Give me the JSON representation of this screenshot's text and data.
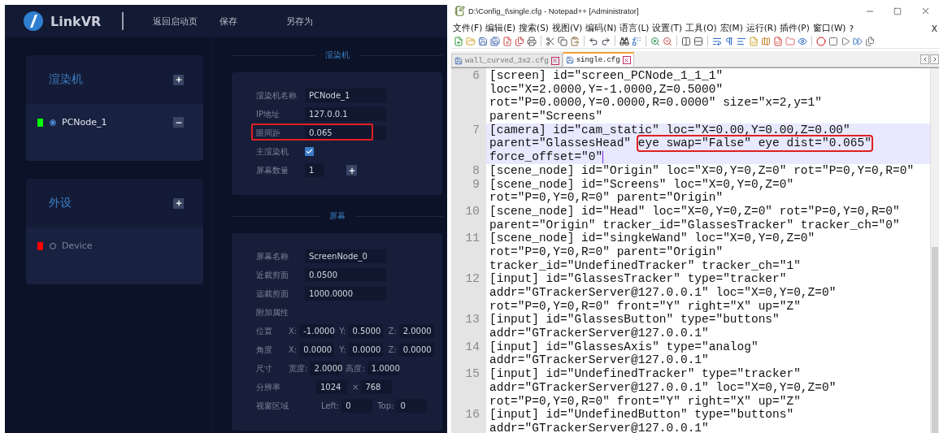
{
  "left_app": {
    "logo": "LinkVR",
    "nav": [
      "返回启动页",
      "保存",
      "另存为"
    ],
    "sidebar_groups": [
      {
        "title": "渲染机",
        "items": [
          {
            "name": "PCNode_1",
            "color": "#00ff00",
            "selected": true
          }
        ]
      },
      {
        "title": "外设",
        "items": [
          {
            "name": "Device",
            "color": "#ff0000",
            "selected": false
          }
        ]
      }
    ],
    "sections": [
      {
        "title": "渲染机",
        "fields": [
          {
            "kind": "text",
            "label": "渲染机名称",
            "value": "PCNode_1",
            "highlighted": false
          },
          {
            "kind": "text",
            "label": "IP地址",
            "value": "127.0.0.1",
            "highlighted": false
          },
          {
            "kind": "text",
            "label": "眼间距",
            "value": "0.065",
            "highlighted": true
          },
          {
            "kind": "checkbox",
            "label": "主渲染机",
            "checked": true
          },
          {
            "kind": "stepper",
            "label": "屏幕数量",
            "value": "1"
          }
        ]
      },
      {
        "title": "屏幕",
        "fields": [
          {
            "kind": "text",
            "label": "屏幕名称",
            "value": "ScreenNode_0",
            "highlighted": false
          },
          {
            "kind": "text",
            "label": "近裁剪面",
            "value": "0.0500",
            "highlighted": false
          },
          {
            "kind": "text",
            "label": "远裁剪面",
            "value": "1000.0000",
            "highlighted": false
          },
          {
            "kind": "heading",
            "label": "附加属性"
          },
          {
            "kind": "multi",
            "label": "位置",
            "parts": [
              {
                "prefix": "X:",
                "value": "-1.0000"
              },
              {
                "prefix": "Y:",
                "value": "0.5000"
              },
              {
                "prefix": "Z:",
                "value": "2.0000"
              }
            ]
          },
          {
            "kind": "multi",
            "label": "角度",
            "parts": [
              {
                "prefix": "X:",
                "value": "0.0000"
              },
              {
                "prefix": "Y:",
                "value": "0.0000"
              },
              {
                "prefix": "Z:",
                "value": "0.0000"
              }
            ]
          },
          {
            "kind": "multi",
            "label": "尺寸",
            "parts": [
              {
                "prefix": "宽度:",
                "value": "2.0000"
              },
              {
                "prefix": "高度:",
                "value": "1.0000"
              }
            ]
          },
          {
            "kind": "multi",
            "label": "分辨率",
            "parts": [
              {
                "value": "1024"
              },
              {
                "prefix": "×",
                "value": "768"
              }
            ]
          },
          {
            "kind": "multi",
            "label": "视窗区域",
            "parts": [
              {
                "prefix": "Left:",
                "value": "0"
              },
              {
                "prefix": "Top:",
                "value": "0"
              }
            ]
          }
        ]
      }
    ]
  },
  "notepad": {
    "title": "D:\\Config_t\\single.cfg - Notepad++ [Administrator]",
    "menu": [
      "文件(F)",
      "编辑(E)",
      "搜索(S)",
      "视图(V)",
      "编码(N)",
      "语言(L)",
      "设置(T)",
      "工具(O)",
      "宏(M)",
      "运行(R)",
      "插件(P)",
      "窗口(W)",
      "?"
    ],
    "doc_close": "X",
    "tabs": [
      {
        "label": "wall_curved_3x2.cfg",
        "selected": false
      },
      {
        "label": "single.cfg",
        "selected": true
      }
    ],
    "lines": [
      {
        "number": "6",
        "current": false,
        "rows": [
          {
            "text": "[screen] id=\"screen_PCNode_1_1_1\""
          },
          {
            "text": "loc=\"X=2.0000,Y=-1.0000,Z=0.5000\""
          },
          {
            "text": "rot=\"P=0.0000,Y=0.0000,R=0.0000\" size=\"x=2,y=1\""
          },
          {
            "text": "parent=\"Screens\""
          }
        ]
      },
      {
        "number": "7",
        "current": true,
        "rows": [
          {
            "text": "[camera] id=\"cam_static\" loc=\"X=0.00,Y=0.00,Z=0.00\""
          },
          {
            "text": "parent=\"GlassesHead\" ",
            "boxed": "eye swap=\"False\" eye dist=\"0.065\""
          },
          {
            "text": "force_offset=\"0\""
          }
        ]
      },
      {
        "number": "8",
        "current": false,
        "rows": [
          {
            "text": "[scene_node] id=\"Origin\" loc=\"X=0,Y=0,Z=0\" rot=\"P=0,Y=0,R=0\""
          }
        ]
      },
      {
        "number": "9",
        "current": false,
        "rows": [
          {
            "text": "[scene_node] id=\"Screens\" loc=\"X=0,Y=0,Z=0\""
          },
          {
            "text": "rot=\"P=0,Y=0,R=0\" parent=\"Origin\""
          }
        ]
      },
      {
        "number": "10",
        "current": false,
        "rows": [
          {
            "text": "[scene_node] id=\"Head\" loc=\"X=0,Y=0,Z=0\" rot=\"P=0,Y=0,R=0\""
          },
          {
            "text": "parent=\"Origin\" tracker_id=\"GlassesTracker\" tracker_ch=\"0\""
          }
        ]
      },
      {
        "number": "11",
        "current": false,
        "rows": [
          {
            "text": "[scene_node] id=\"singkeWand\" loc=\"X=0,Y=0,Z=0\""
          },
          {
            "text": "rot=\"P=0,Y=0,R=0\" parent=\"Origin\""
          },
          {
            "text": "tracker_id=\"UndefinedTracker\" tracker_ch=\"1\""
          }
        ]
      },
      {
        "number": "12",
        "current": false,
        "rows": [
          {
            "text": "[input] id=\"GlassesTracker\" type=\"tracker\""
          },
          {
            "text": "addr=\"GTrackerServer@127.0.0.1\" loc=\"X=0,Y=0,Z=0\""
          },
          {
            "text": "rot=\"P=0,Y=0,R=0\" front=\"Y\" right=\"X\" up=\"Z\""
          }
        ]
      },
      {
        "number": "13",
        "current": false,
        "rows": [
          {
            "text": "[input] id=\"GlassesButton\" type=\"buttons\""
          },
          {
            "text": "addr=\"GTrackerServer@127.0.0.1\""
          }
        ]
      },
      {
        "number": "14",
        "current": false,
        "rows": [
          {
            "text": "[input] id=\"GlassesAxis\" type=\"analog\""
          },
          {
            "text": "addr=\"GTrackerServer@127.0.0.1\""
          }
        ]
      },
      {
        "number": "15",
        "current": false,
        "rows": [
          {
            "text": "[input] id=\"UndefinedTracker\" type=\"tracker\""
          },
          {
            "text": "addr=\"GTrackerServer@127.0.0.1\" loc=\"X=0,Y=0,Z=0\""
          },
          {
            "text": "rot=\"P=0,Y=0,R=0\" front=\"Y\" right=\"X\" up=\"Z\""
          }
        ]
      },
      {
        "number": "16",
        "current": false,
        "rows": [
          {
            "text": "[input] id=\"UndefinedButton\" type=\"buttons\""
          },
          {
            "text": "addr=\"GTrackerServer@127.0.0.1\""
          }
        ]
      }
    ]
  }
}
